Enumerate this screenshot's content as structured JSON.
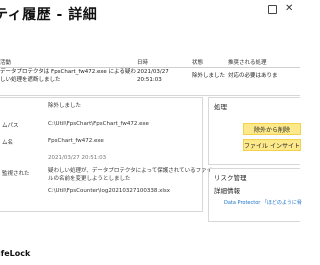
{
  "window": {
    "title": "ティ履歴 - 詳細",
    "help_icon": "help-icon",
    "close_icon": "close-icon"
  },
  "event_table": {
    "headers": [
      "活動",
      "日時",
      "状態",
      "推奨される処理"
    ],
    "row": {
      "activity_line1": "データプロテクタは FpsChart_fw472.exe による疑わ",
      "activity_line2": "しい処理を遮断しました",
      "date": "2021/03/27",
      "time": "20:51:03",
      "status": "除外しました",
      "recommended": "対応の必要はありま"
    }
  },
  "details": [
    {
      "label": "",
      "value": "除外しました",
      "gray": false
    },
    {
      "label": "ムパス",
      "value": "C:\\Util\\FpsChart\\FpsChart_fw472.exe",
      "gray": false
    },
    {
      "label": "ム名",
      "value": "FpsChart_fw472.exe",
      "gray": false
    },
    {
      "label": "",
      "value": "2021/03/27 20:51:03",
      "gray": true
    },
    {
      "label": "監視された",
      "value": "疑わしい処理が、データプロテクタによって保護されているファイ",
      "value2": "ルの名前を変更しようとしました",
      "gray": false
    },
    {
      "label": "",
      "value": "C:\\Util\\FpsCounter\\log20210327100338.xlsx",
      "gray": false
    }
  ],
  "actions": {
    "title": "処理",
    "exclude_button": "除外から削除",
    "file_insight_button": "ファイル インサイト"
  },
  "risk": {
    "title": "リスク管理",
    "subtitle": "詳細情報",
    "link": "Data Protector 「ほどのように脅"
  },
  "footer": {
    "brand": "ifeLock"
  }
}
